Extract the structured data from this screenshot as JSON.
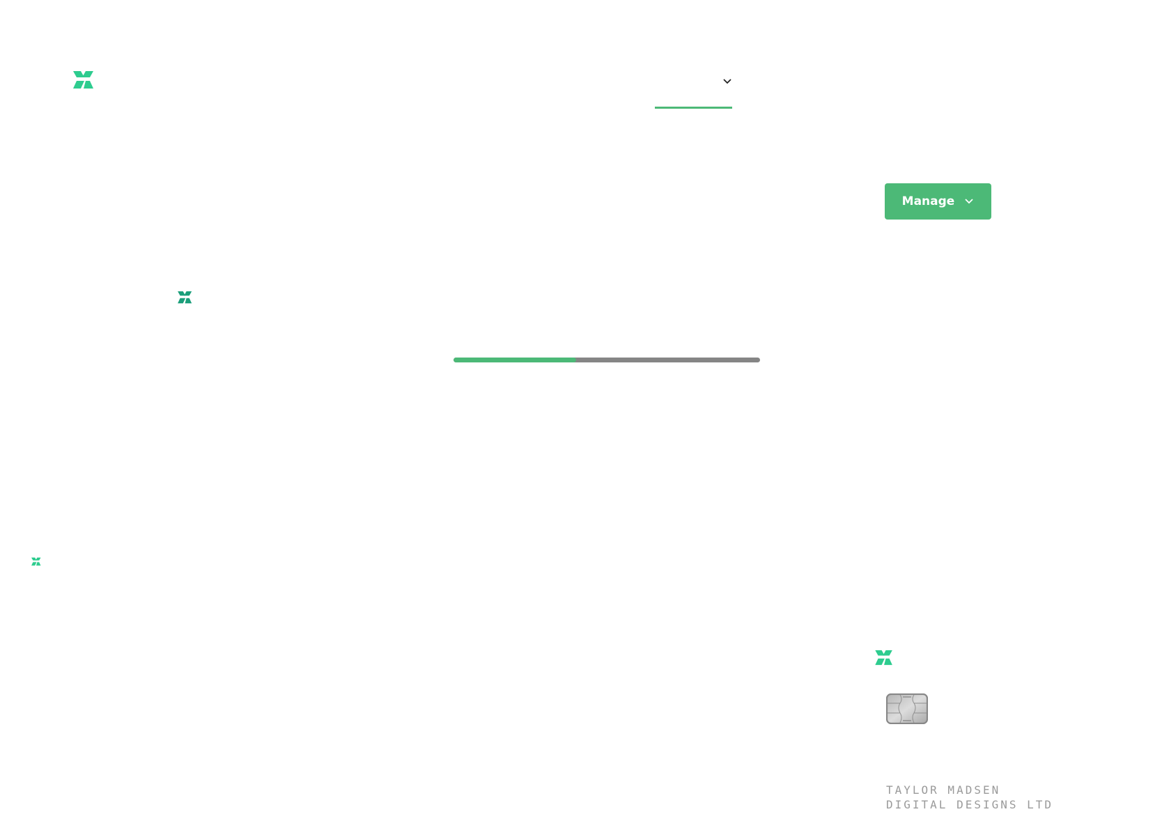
{
  "colors": {
    "brand_green": "#2ecc8f",
    "accent_green": "#4cb977",
    "progress_track": "#858585",
    "chip_gray": "#8a8a8a",
    "cardholder_text": "#9a9a9a"
  },
  "header": {
    "logo_icon": "brand-logo-icon",
    "nav_dropdown": {
      "label": "",
      "icon": "chevron-down-icon",
      "active": true
    }
  },
  "actions": {
    "manage_label": "Manage",
    "manage_icon": "chevron-down-icon"
  },
  "progress": {
    "value_percent": 40
  },
  "card": {
    "logo_icon": "brand-logo-icon",
    "chip_icon": "card-chip-icon",
    "holder_name": "TAYLOR MADSEN",
    "holder_company": "DIGITAL DESIGNS LTD"
  }
}
